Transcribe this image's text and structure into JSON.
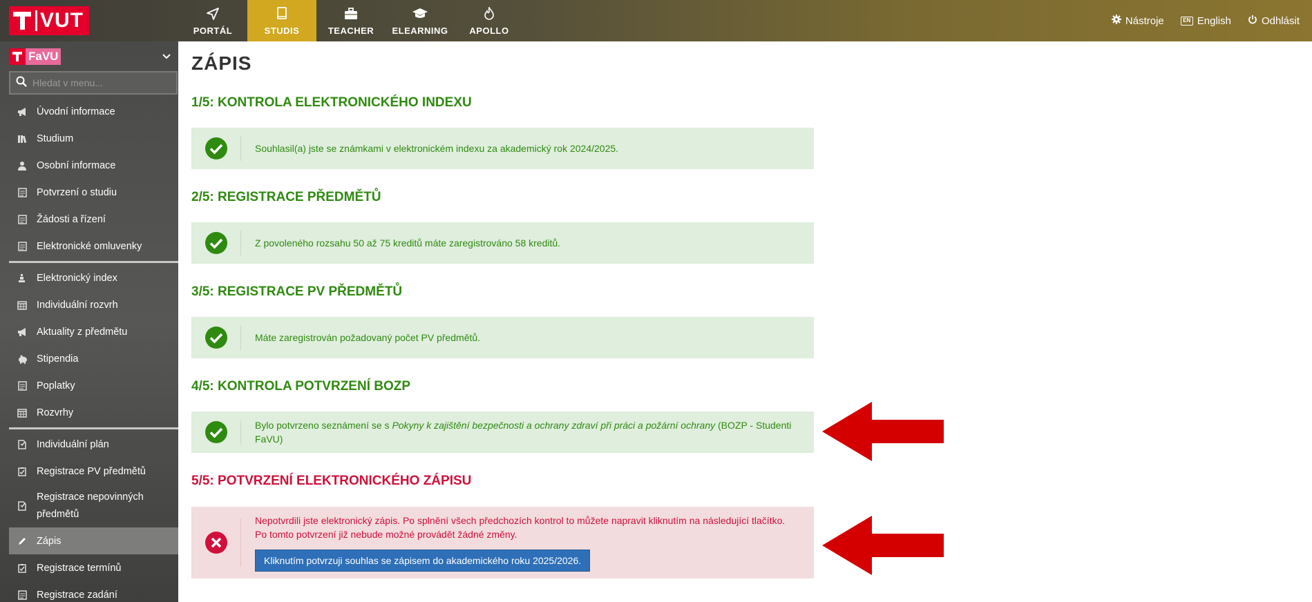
{
  "header": {
    "logo_text": "VUT",
    "nav": [
      {
        "label": "PORTÁL",
        "icon": "send-icon"
      },
      {
        "label": "STUDIS",
        "icon": "book-icon",
        "active": true
      },
      {
        "label": "TEACHER",
        "icon": "briefcase-icon"
      },
      {
        "label": "ELEARNING",
        "icon": "graduation-cap-icon"
      },
      {
        "label": "APOLLO",
        "icon": "flame-icon"
      }
    ],
    "tools_label": "Nástroje",
    "lang_badge": "EN",
    "lang_label": "English",
    "logout_label": "Odhlásit"
  },
  "sidebar": {
    "faculty": "FaVU",
    "search_placeholder": "Hledat v menu...",
    "items": [
      {
        "label": "Úvodní informace",
        "icon": "megaphone-icon"
      },
      {
        "label": "Studium",
        "icon": "books-icon"
      },
      {
        "label": "Osobní informace",
        "icon": "user-icon"
      },
      {
        "label": "Potvrzení o studiu",
        "icon": "document-icon"
      },
      {
        "label": "Žádosti a řízení",
        "icon": "document-icon"
      },
      {
        "label": "Elektronické omluvenky",
        "icon": "document-icon"
      },
      {
        "label": "Elektronický index",
        "icon": "index-icon"
      },
      {
        "label": "Individuální rozvrh",
        "icon": "calendar-icon"
      },
      {
        "label": "Aktuality z předmětu",
        "icon": "megaphone-icon"
      },
      {
        "label": "Stipendia",
        "icon": "piggy-bank-icon"
      },
      {
        "label": "Poplatky",
        "icon": "document-icon"
      },
      {
        "label": "Rozvrhy",
        "icon": "calendar-icon"
      },
      {
        "label": "Individuální plán",
        "icon": "plan-icon"
      },
      {
        "label": "Registrace PV předmětů",
        "icon": "clipboard-icon"
      },
      {
        "label": "Registrace nepovinných předmětů",
        "icon": "plan-icon"
      },
      {
        "label": "Zápis",
        "icon": "pencil-icon",
        "active": true
      },
      {
        "label": "Registrace termínů",
        "icon": "clipboard-icon"
      },
      {
        "label": "Registrace zadání",
        "icon": "document-icon"
      }
    ]
  },
  "main": {
    "title": "ZÁPIS",
    "steps": [
      {
        "heading": "1/5: KONTROLA ELEKTRONICKÉHO INDEXU",
        "status": "ok",
        "text": "Souhlasil(a) jste se známkami v elektronickém indexu za akademický rok 2024/2025."
      },
      {
        "heading": "2/5: REGISTRACE PŘEDMĚTŮ",
        "status": "ok",
        "text": "Z povoleného rozsahu 50 až 75 kreditů máte zaregistrováno 58 kreditů."
      },
      {
        "heading": "3/5: REGISTRACE PV PŘEDMĚTŮ",
        "status": "ok",
        "text": "Máte zaregistrován požadovaný počet PV předmětů."
      },
      {
        "heading": "4/5: KONTROLA POTVRZENÍ BOZP",
        "status": "ok",
        "text_pre": "Bylo potvrzeno seznámení se s ",
        "text_em": "Pokyny k zajištění bezpečnosti a ochrany zdraví při práci a požární ochrany",
        "text_post": " (BOZP - Studenti FaVU)"
      },
      {
        "heading": "5/5: POTVRZENÍ ELEKTRONICKÉHO ZÁPISU",
        "status": "error",
        "text_line1": "Nepotvrdili jste elektronický zápis. Po splnění všech předchozích kontrol to můžete napravit kliknutím na následující tlačítko.",
        "text_line2": "Po tomto potvrzení již nebude možné provádět žádné změny.",
        "button_label": "Kliknutím potvrzuji souhlas se zápisem do akademického roku 2025/2026."
      }
    ]
  },
  "colors": {
    "ok_green": "#2f8a10",
    "ok_bg": "#dfeedd",
    "error_red": "#d0103a",
    "error_bg": "#f3dcde",
    "active_nav": "#d1a81f",
    "brand_red": "#e4002b",
    "arrow_red": "#d40000",
    "button_blue": "#2e6fb8"
  }
}
